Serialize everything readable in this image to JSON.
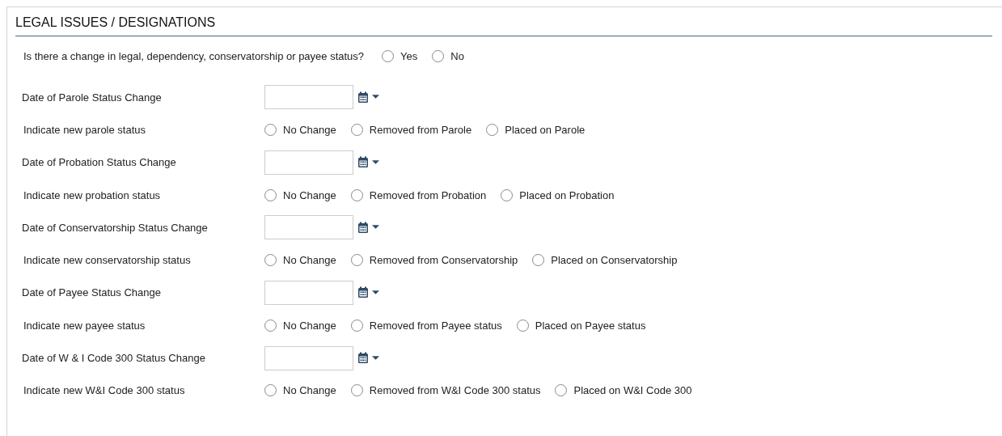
{
  "section": {
    "title": "LEGAL ISSUES / DESIGNATIONS"
  },
  "question": {
    "label": "Is there a change in legal, dependency, conservatorship or payee status?",
    "options": [
      {
        "label": "Yes",
        "selected": false
      },
      {
        "label": "No",
        "selected": false
      }
    ]
  },
  "rows": [
    {
      "kind": "date",
      "label": "Date of Parole Status Change"
    },
    {
      "kind": "radio",
      "label": "Indicate new parole status",
      "options": [
        {
          "label": "No Change",
          "selected": false
        },
        {
          "label": "Removed from Parole",
          "selected": false
        },
        {
          "label": "Placed on Parole",
          "selected": false
        }
      ]
    },
    {
      "kind": "date",
      "label": "Date of Probation Status Change"
    },
    {
      "kind": "radio",
      "label": "Indicate new probation status",
      "options": [
        {
          "label": "No Change",
          "selected": false
        },
        {
          "label": "Removed from Probation",
          "selected": false
        },
        {
          "label": "Placed on Probation",
          "selected": false
        }
      ]
    },
    {
      "kind": "date",
      "label": "Date of Conservatorship Status Change"
    },
    {
      "kind": "radio",
      "label": "Indicate new conservatorship status",
      "options": [
        {
          "label": "No Change",
          "selected": false
        },
        {
          "label": "Removed from Conservatorship",
          "selected": false
        },
        {
          "label": "Placed on Conservatorship",
          "selected": false
        }
      ]
    },
    {
      "kind": "date",
      "label": "Date of Payee Status Change"
    },
    {
      "kind": "radio",
      "label": "Indicate new payee status",
      "options": [
        {
          "label": "No Change",
          "selected": false
        },
        {
          "label": "Removed from Payee status",
          "selected": false
        },
        {
          "label": "Placed on Payee status",
          "selected": false
        }
      ]
    },
    {
      "kind": "date",
      "label": "Date of W & I Code 300 Status Change"
    },
    {
      "kind": "radio",
      "label": "Indicate new W&I Code 300 status",
      "options": [
        {
          "label": "No Change",
          "selected": false
        },
        {
          "label": "Removed from W&I Code 300 status",
          "selected": false
        },
        {
          "label": "Placed on W&I Code 300",
          "selected": false
        }
      ]
    }
  ]
}
